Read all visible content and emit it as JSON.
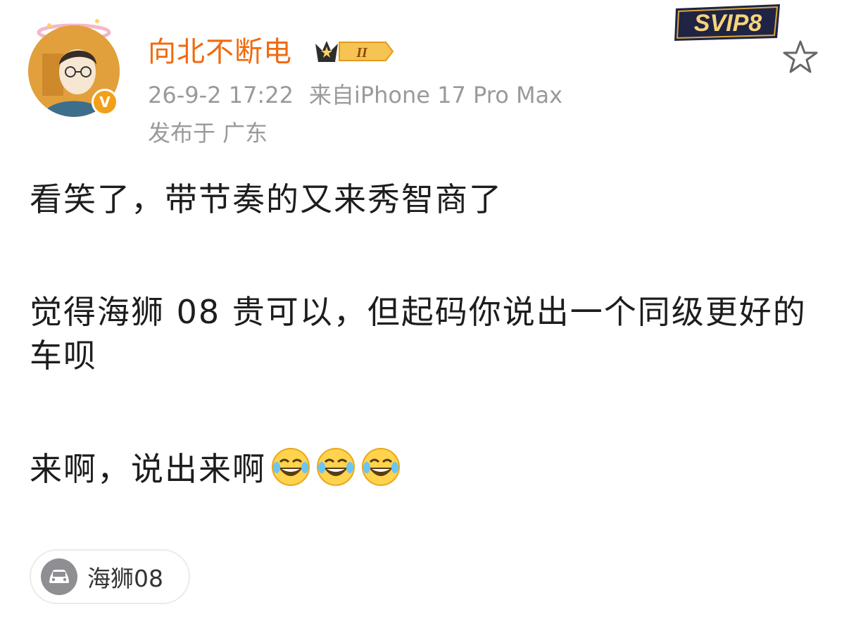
{
  "post": {
    "author": {
      "name": "向北不断电",
      "level_badge": "II",
      "vip_badge": "SVIP8",
      "verified_mark": "V"
    },
    "meta": {
      "timestamp": "26-9-2 17:22",
      "source": "来自iPhone 17 Pro Max",
      "location": "发布于 广东"
    },
    "content": {
      "line1": "看笑了，带节奏的又来秀智商了",
      "line2": "觉得海狮 08 贵可以，但起码你说出一个同级更好的车呗",
      "line3": "来啊，说出来啊",
      "emojis": [
        "laugh-cry-emoji",
        "laugh-cry-emoji",
        "laugh-cry-emoji"
      ]
    },
    "topic": {
      "label": "海狮08",
      "icon": "car-icon"
    }
  },
  "colors": {
    "username": "#f06a0f",
    "meta": "#9a9a9a",
    "text": "#1d1d1d",
    "verified": "#f2a01a"
  }
}
